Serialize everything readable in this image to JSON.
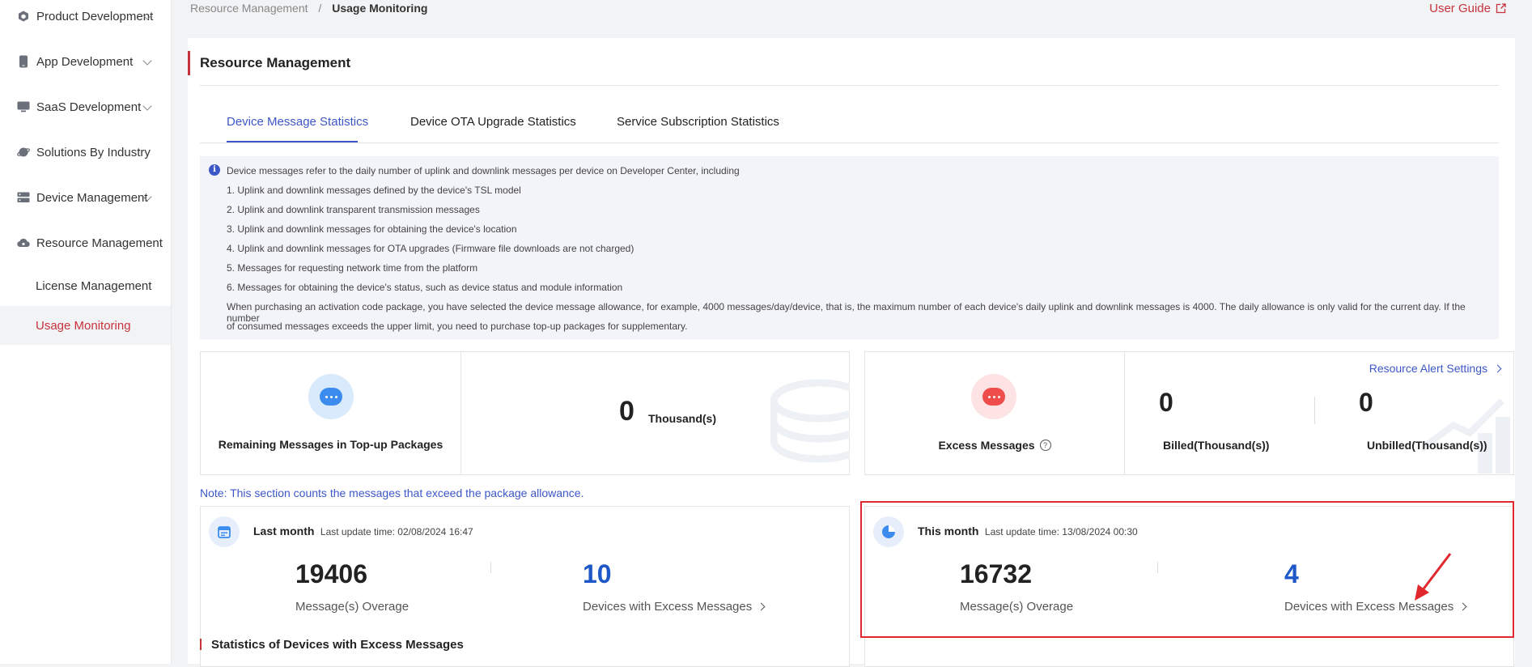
{
  "sidebar": {
    "items": [
      {
        "label": "Product Development",
        "icon": "cube-icon",
        "expandable": true
      },
      {
        "label": "App Development",
        "icon": "phone-icon",
        "expandable": true
      },
      {
        "label": "SaaS Development",
        "icon": "monitor-icon",
        "expandable": true
      },
      {
        "label": "Solutions By Industry",
        "icon": "planet-icon",
        "expandable": false
      },
      {
        "label": "Device Management",
        "icon": "server-icon",
        "expandable": true
      },
      {
        "label": "Resource Management",
        "icon": "cloud-gear-icon",
        "expandable": false
      }
    ],
    "sub_items": [
      {
        "label": "License Management",
        "active": false
      },
      {
        "label": "Usage Monitoring",
        "active": true
      }
    ]
  },
  "breadcrumb": {
    "parent": "Resource Management",
    "separator": "/",
    "current": "Usage Monitoring"
  },
  "user_guide": "User Guide",
  "page_title": "Resource Management",
  "tabs": [
    {
      "label": "Device Message Statistics",
      "active": true
    },
    {
      "label": "Device OTA Upgrade Statistics",
      "active": false
    },
    {
      "label": "Service Subscription Statistics",
      "active": false
    }
  ],
  "info": {
    "lines": [
      "Device messages refer to the daily number of uplink and downlink messages per device on Developer Center, including",
      "1. Uplink and downlink messages defined by the device's TSL model",
      "2. Uplink and downlink transparent transmission messages",
      "3. Uplink and downlink messages for obtaining the device's location",
      "4. Uplink and downlink messages for OTA upgrades (Firmware file downloads are not charged)",
      "5. Messages for requesting network time from the platform",
      "6. Messages for obtaining the device's status, such as device status and module information",
      "When purchasing an activation code package, you have selected the device message allowance, for example, 4000 messages/day/device, that is, the maximum number of each device's daily uplink and downlink messages is 4000. The daily allowance is only valid for the current day. If the number",
      "of consumed messages exceeds the upper limit, you need to purchase top-up packages for supplementary."
    ]
  },
  "remaining": {
    "label": "Remaining Messages in Top-up Packages",
    "value": "0",
    "unit": "Thousand(s)"
  },
  "excess": {
    "label": "Excess Messages",
    "alert_link": "Resource Alert Settings",
    "billed_value": "0",
    "billed_label": "Billed(Thousand(s))",
    "unbilled_value": "0",
    "unbilled_label": "Unbilled(Thousand(s))"
  },
  "note": "Note: This section counts the messages that exceed the package allowance.",
  "last_month": {
    "title": "Last month",
    "update": "Last update time: 02/08/2024 16:47",
    "overage_value": "19406",
    "overage_label": "Message(s) Overage",
    "devices_value": "10",
    "devices_label": "Devices with Excess Messages"
  },
  "this_month": {
    "title": "This month",
    "update": "Last update time: 13/08/2024 00:30",
    "overage_value": "16732",
    "overage_label": "Message(s) Overage",
    "devices_value": "4",
    "devices_label": "Devices with Excess Messages"
  },
  "section2_title": "Statistics of Devices with Excess Messages",
  "colors": {
    "brand_red": "#c8323c",
    "accent_blue": "#3d57c7",
    "number_blue": "#1d57c8",
    "highlight_box": "#e0282e"
  }
}
